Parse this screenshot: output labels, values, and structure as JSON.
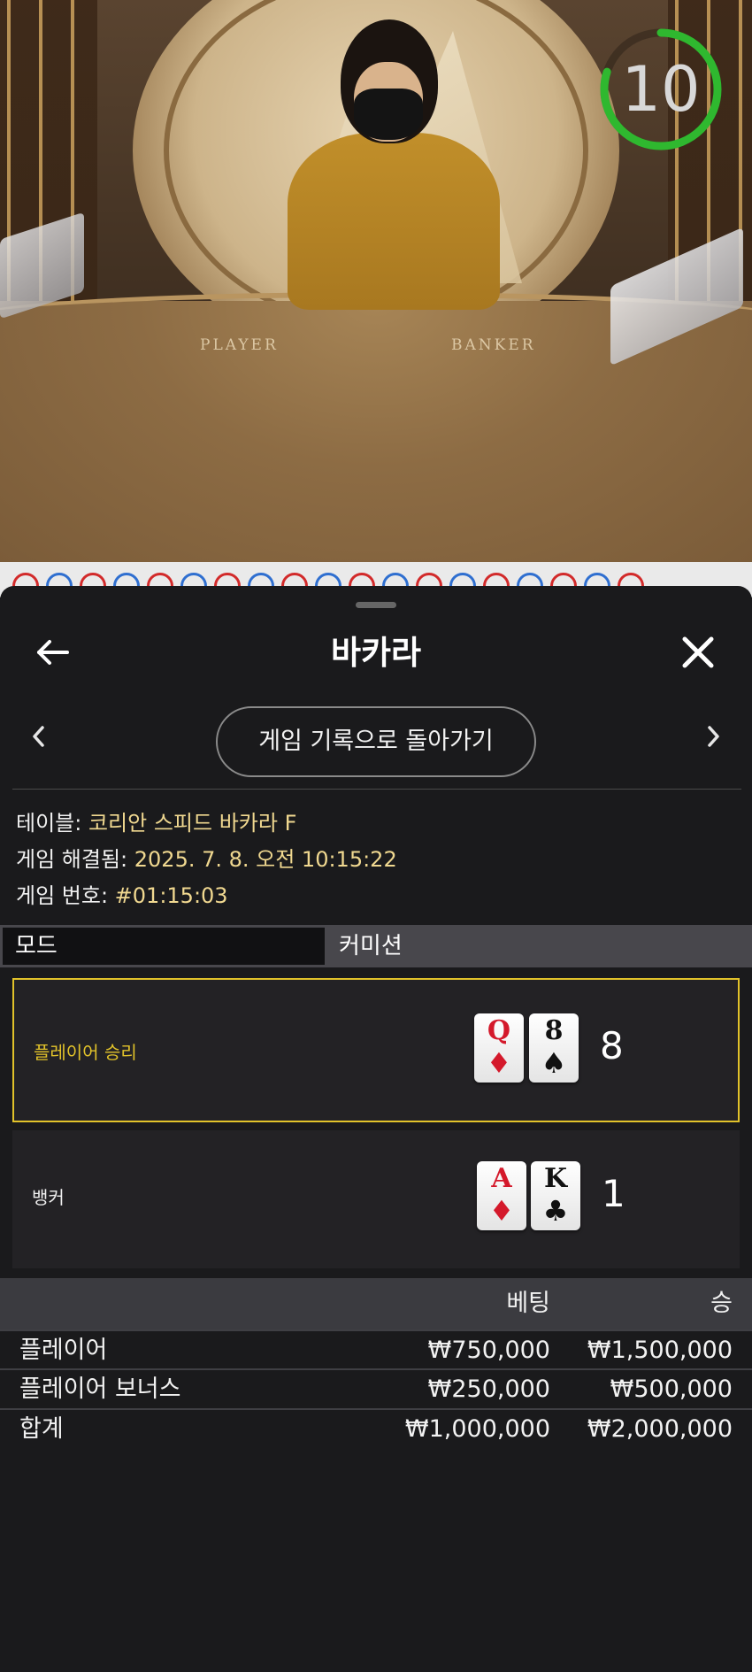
{
  "video": {
    "countdown": "10",
    "countdown_fraction": 0.8,
    "table_labels": [
      "PLAYER",
      "BANKER"
    ]
  },
  "road": {
    "beads": [
      "red",
      "blue",
      "red",
      "blue",
      "red",
      "blue",
      "red",
      "blue",
      "red",
      "blue",
      "red",
      "blue",
      "red",
      "blue",
      "red",
      "blue",
      "red",
      "blue",
      "red"
    ]
  },
  "header": {
    "title": "바카라",
    "back_icon": "arrow-left-icon",
    "close_icon": "close-icon"
  },
  "nav": {
    "back_to_history": "게임 기록으로 돌아가기",
    "prev_icon": "chevron-left-icon",
    "next_icon": "chevron-right-icon"
  },
  "info": {
    "table_label": "테이블:",
    "table_value": " 코리안 스피드 바카라 F",
    "resolved_label": "게임 해결됨:",
    "resolved_value": " 2025. 7. 8. 오전 10:15:22",
    "number_label": "게임 번호:",
    "number_value": " #01:15:03"
  },
  "mode": {
    "label": "모드",
    "value": "커미션"
  },
  "results": {
    "player": {
      "label": "플레이어 승리",
      "cards": [
        {
          "rank": "Q",
          "suit": "♦",
          "color": "red"
        },
        {
          "rank": "8",
          "suit": "♠",
          "color": "black"
        }
      ],
      "score": "8"
    },
    "banker": {
      "label": "뱅커",
      "cards": [
        {
          "rank": "A",
          "suit": "♦",
          "color": "red"
        },
        {
          "rank": "K",
          "suit": "♣",
          "color": "black"
        }
      ],
      "score": "1"
    }
  },
  "bets": {
    "headers": {
      "bet": "베팅",
      "win": "승"
    },
    "rows": [
      {
        "name": "플레이어",
        "bet": "₩750,000",
        "win": "₩1,500,000"
      },
      {
        "name": "플레이어 보너스",
        "bet": "₩250,000",
        "win": "₩500,000"
      }
    ],
    "total": {
      "name": "합계",
      "bet": "₩1,000,000",
      "win": "₩2,000,000"
    }
  },
  "colors": {
    "accent_gold": "#e1c22a",
    "info_text": "#f0d890",
    "timer_green": "#2fb82f",
    "red_suit": "#d4192b"
  }
}
